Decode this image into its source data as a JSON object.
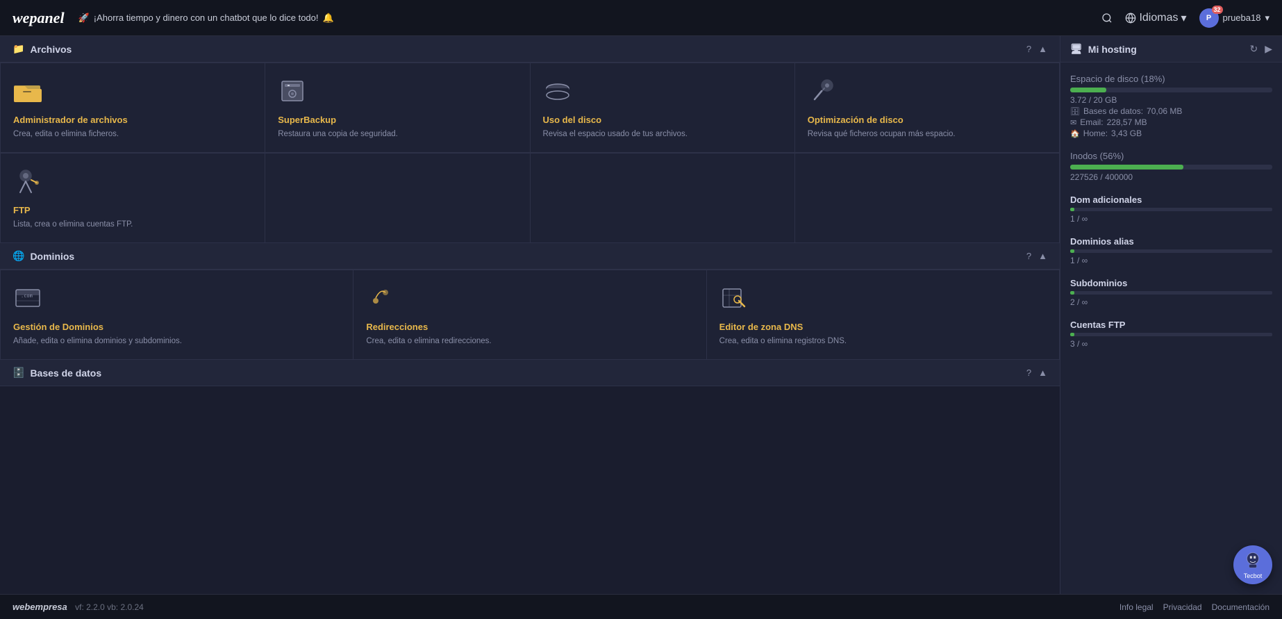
{
  "topnav": {
    "logo": "wepanel",
    "announcement": "¡Ahorra tiempo y dinero con un chatbot que lo dice todo!",
    "search_label": "Buscar",
    "language_label": "Idiomas",
    "user_label": "prueba18",
    "user_badge": "32"
  },
  "sections": [
    {
      "id": "archivos",
      "icon": "📁",
      "title": "Archivos",
      "cards": [
        {
          "icon": "📂",
          "title": "Administrador de archivos",
          "desc": "Crea, edita o elimina ficheros."
        },
        {
          "icon": "🔒",
          "title": "SuperBackup",
          "desc": "Restaura una copia de seguridad."
        },
        {
          "icon": "💾",
          "title": "Uso del disco",
          "desc": "Revisa el espacio usado de tus archivos."
        },
        {
          "icon": "🔧",
          "title": "Optimización de disco",
          "desc": "Revisa qué ficheros ocupan más espacio."
        }
      ],
      "extra_cards": [
        {
          "icon": "👤",
          "title": "FTP",
          "desc": "Lista, crea o elimina cuentas FTP."
        }
      ]
    },
    {
      "id": "dominios",
      "icon": "🌐",
      "title": "Dominios",
      "cards": [
        {
          "icon": "🔲",
          "title": "Gestión de Dominios",
          "desc": "Añade, edita o elimina dominios y subdominios."
        },
        {
          "icon": "📍",
          "title": "Redirecciones",
          "desc": "Crea, edita o elimina redirecciones."
        },
        {
          "icon": "📝",
          "title": "Editor de zona DNS",
          "desc": "Crea, edita o elimina registros DNS."
        }
      ]
    },
    {
      "id": "bases_datos",
      "icon": "🗄️",
      "title": "Bases de datos"
    }
  ],
  "sidebar": {
    "title": "Mi hosting",
    "disk_label": "Espacio de disco",
    "disk_percent": "18%",
    "disk_fill": 18,
    "disk_value": "3.72 / 20 GB",
    "disk_db_label": "Bases de datos:",
    "disk_db_value": "70,06 MB",
    "disk_email_label": "Email:",
    "disk_email_value": "228,57 MB",
    "disk_home_label": "Home:",
    "disk_home_value": "3,43 GB",
    "inodos_label": "Inodos",
    "inodos_percent": "56%",
    "inodos_fill": 56,
    "inodos_value": "227526 / 400000",
    "dom_adicionales_label": "Dom adicionales",
    "dom_adicionales_value": "1 / ∞",
    "dom_adicionales_fill": 2,
    "dominios_alias_label": "Dominios alias",
    "dominios_alias_value": "1 / ∞",
    "dominios_alias_fill": 2,
    "subdominios_label": "Subdominios",
    "subdominios_value": "2 / ∞",
    "subdominios_fill": 2,
    "cuentas_ftp_label": "Cuentas FTP",
    "cuentas_ftp_value": "3 / ∞",
    "cuentas_ftp_fill": 2
  },
  "footer": {
    "brand": "webempresa",
    "version": "vf: 2.2.0 vb: 2.0.24",
    "links": [
      "Info legal",
      "Privacidad",
      "Documentación"
    ]
  },
  "tecbot": {
    "label": "Tecbot"
  }
}
